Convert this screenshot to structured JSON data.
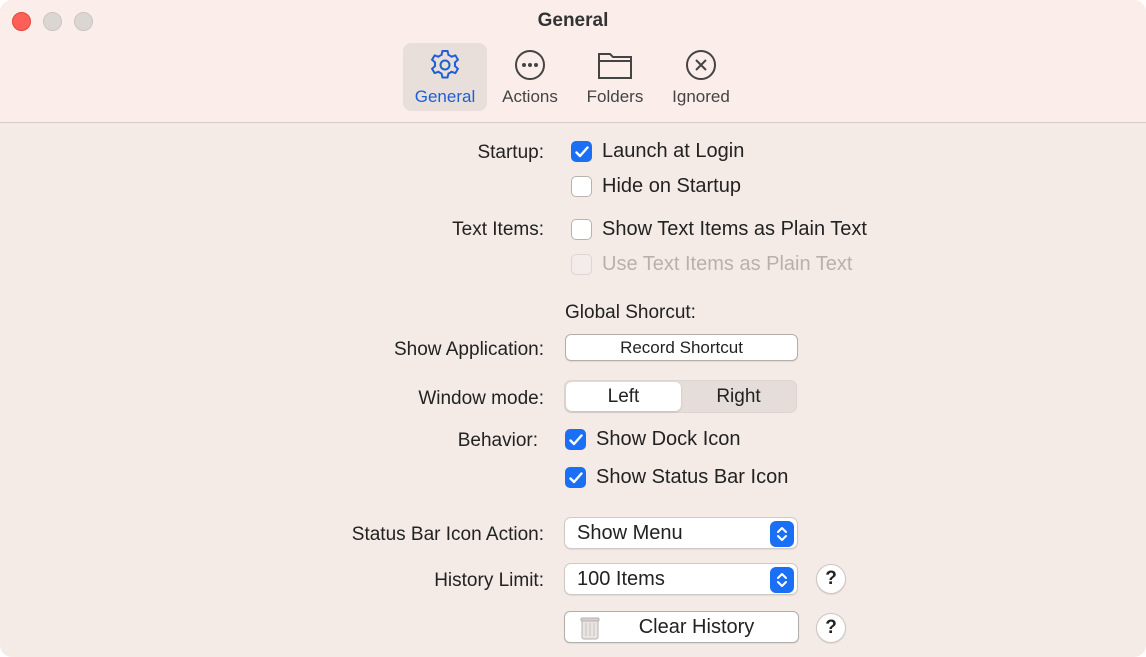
{
  "window": {
    "title": "General"
  },
  "toolbar": {
    "tabs": [
      {
        "label": "General",
        "icon": "gear-icon"
      },
      {
        "label": "Actions",
        "icon": "ellipsis-circle-icon"
      },
      {
        "label": "Folders",
        "icon": "folder-icon"
      },
      {
        "label": "Ignored",
        "icon": "x-circle-icon"
      }
    ]
  },
  "startup": {
    "label": "Startup:",
    "launch_at_login": {
      "label": "Launch at Login",
      "checked": true
    },
    "hide_on_startup": {
      "label": "Hide on Startup",
      "checked": false
    }
  },
  "text_items": {
    "label": "Text Items:",
    "show_plain": {
      "label": "Show Text Items as Plain Text",
      "checked": false
    },
    "use_plain": {
      "label": "Use Text Items as Plain Text",
      "checked": false,
      "disabled": true
    }
  },
  "shortcut": {
    "heading": "Global Shorcut:",
    "label": "Show Application:",
    "button": "Record Shortcut"
  },
  "window_mode": {
    "label": "Window mode:",
    "options": [
      "Left",
      "Right"
    ],
    "selected": "Left"
  },
  "behavior": {
    "label": "Behavior:",
    "dock_icon": {
      "label": "Show Dock Icon",
      "checked": true
    },
    "status_bar_icon": {
      "label": "Show Status Bar Icon",
      "checked": true
    }
  },
  "status_bar_action": {
    "label": "Status Bar Icon Action:",
    "value": "Show Menu"
  },
  "history_limit": {
    "label": "History Limit:",
    "value": "100 Items",
    "help": "?"
  },
  "clear_history": {
    "label": "Clear History",
    "help": "?"
  },
  "colors": {
    "accent": "#1a6ff5",
    "close": "#fe5f57"
  }
}
